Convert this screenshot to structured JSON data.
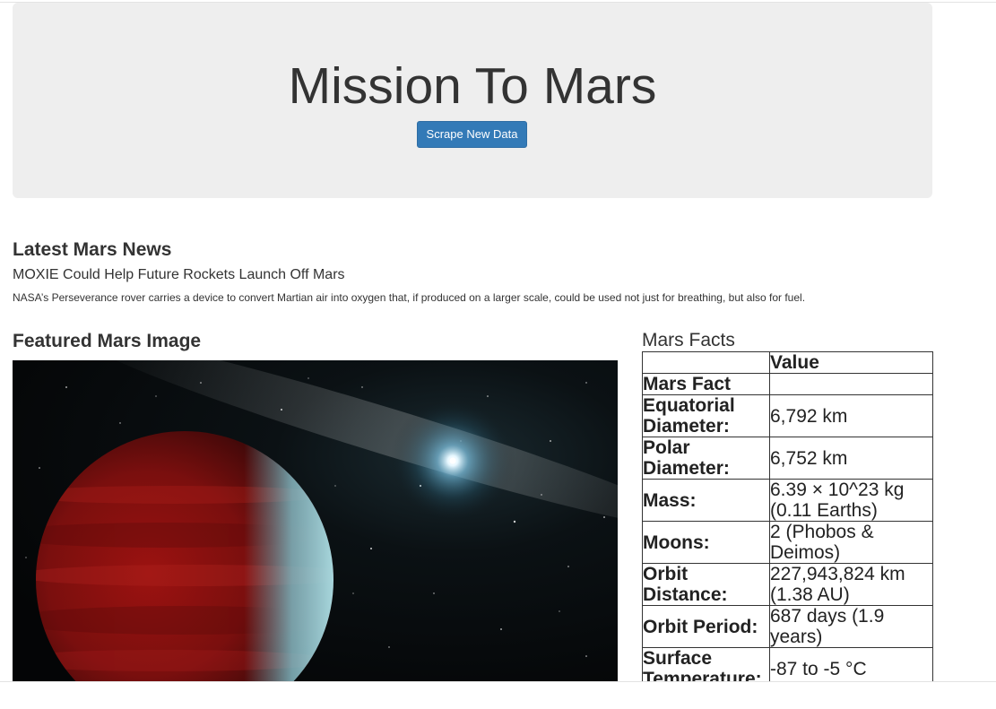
{
  "header": {
    "title": "Mission To Mars",
    "button_label": "Scrape New Data",
    "button_color": "#337ab7"
  },
  "news": {
    "heading": "Latest Mars News",
    "title": "MOXIE Could Help Future Rockets Launch Off Mars",
    "teaser": "NASA’s Perseverance rover carries a device to convert Martian air into oxygen that, if produced on a larger scale, could be used not just for breathing, but also for fuel."
  },
  "featured_image": {
    "heading": "Featured Mars Image"
  },
  "facts": {
    "heading": "Mars Facts",
    "columns": [
      "",
      "Value"
    ],
    "index_label": "Mars Fact",
    "rows": [
      {
        "label": "Equatorial Diameter:",
        "value": "6,792 km"
      },
      {
        "label": "Polar Diameter:",
        "value": "6,752 km"
      },
      {
        "label": "Mass:",
        "value": "6.39 × 10^23 kg (0.11 Earths)"
      },
      {
        "label": "Moons:",
        "value": "2 (Phobos & Deimos)"
      },
      {
        "label": "Orbit Distance:",
        "value": "227,943,824 km (1.38 AU)"
      },
      {
        "label": "Orbit Period:",
        "value": "687 days (1.9 years)"
      },
      {
        "label": "Surface Temperature:",
        "value": "-87 to -5 °C"
      }
    ]
  }
}
